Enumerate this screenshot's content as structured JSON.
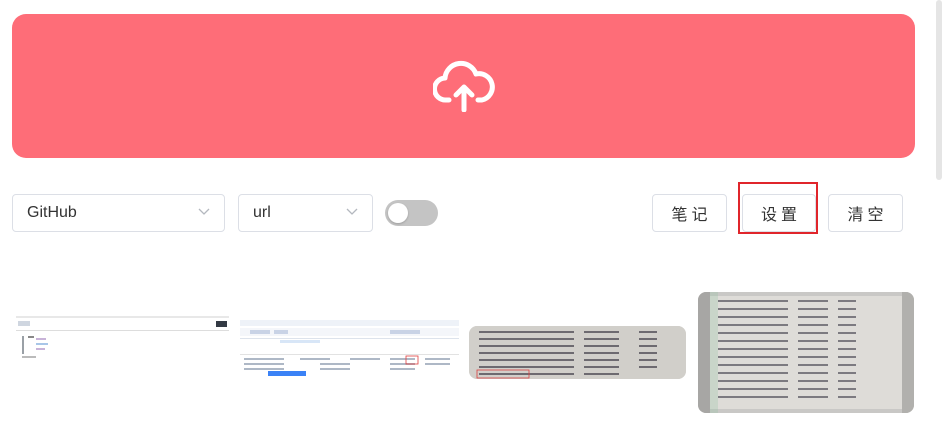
{
  "upload": {
    "icon": "cloud-upload-icon",
    "background": "#fe6d78"
  },
  "controls": {
    "repo_select_value": "GitHub",
    "format_select_value": "url",
    "toggle_on": false,
    "notes_label": "笔记",
    "settings_label": "设置",
    "clear_label": "清空",
    "highlight_color": "#e0252b"
  },
  "thumbnails": [
    {
      "id": "thumb-1",
      "kind": "code-editor-screenshot"
    },
    {
      "id": "thumb-2",
      "kind": "spreadsheet-screenshot"
    },
    {
      "id": "thumb-3",
      "kind": "table-photo"
    },
    {
      "id": "thumb-4",
      "kind": "document-photo"
    }
  ]
}
